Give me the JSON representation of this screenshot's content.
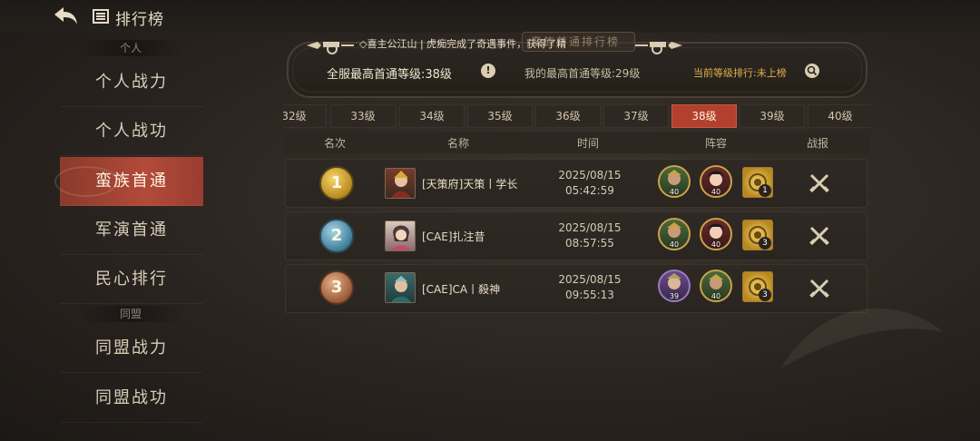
{
  "header": {
    "title": "排行榜",
    "back_icon": "back-arrow-icon",
    "title_icon": "ranking-book-icon"
  },
  "sidebar": {
    "section_personal": "个人",
    "section_alliance": "同盟",
    "items": [
      {
        "label": "个人战力"
      },
      {
        "label": "个人战功"
      },
      {
        "label": "蛮族首通",
        "active": true
      },
      {
        "label": "军演首通"
      },
      {
        "label": "民心排行"
      },
      {
        "label": "同盟战力"
      },
      {
        "label": "同盟战功"
      }
    ]
  },
  "announcement": {
    "ticker": "◇喜主公江山 | 虎痴完成了奇遇事件，获得了精",
    "tab_label": "蛮族首通排行榜",
    "server_level": "全服最高首通等级:38级",
    "info_icon": "!",
    "my_level": "我的最高首通等级:29级",
    "rank_status": "当前等级排行:未上榜"
  },
  "tabs": [
    "32级",
    "33级",
    "34级",
    "35级",
    "36级",
    "37级",
    "38级",
    "39级",
    "40级"
  ],
  "active_tab": "38级",
  "table": {
    "headers": [
      "名次",
      "名称",
      "时间",
      "阵容",
      "战报"
    ],
    "rows": [
      {
        "rank": "1",
        "name": "[天策府]天策丨学长",
        "date": "2025/08/15",
        "time": "05:42:59",
        "heroes": [
          {
            "lvl": "40"
          },
          {
            "lvl": "40"
          }
        ],
        "skill_lvl": "1"
      },
      {
        "rank": "2",
        "name": "[CAE]扎注昔",
        "date": "2025/08/15",
        "time": "08:57:55",
        "heroes": [
          {
            "lvl": "40"
          },
          {
            "lvl": "40"
          }
        ],
        "skill_lvl": "3"
      },
      {
        "rank": "3",
        "name": "[CAE]CA丨殺神",
        "date": "2025/08/15",
        "time": "09:55:13",
        "heroes": [
          {
            "lvl": "39"
          },
          {
            "lvl": "40"
          }
        ],
        "skill_lvl": "3"
      }
    ]
  },
  "colors": {
    "accent": "#b2402e",
    "gold": "#e0b04a",
    "background": "#2a2420"
  }
}
